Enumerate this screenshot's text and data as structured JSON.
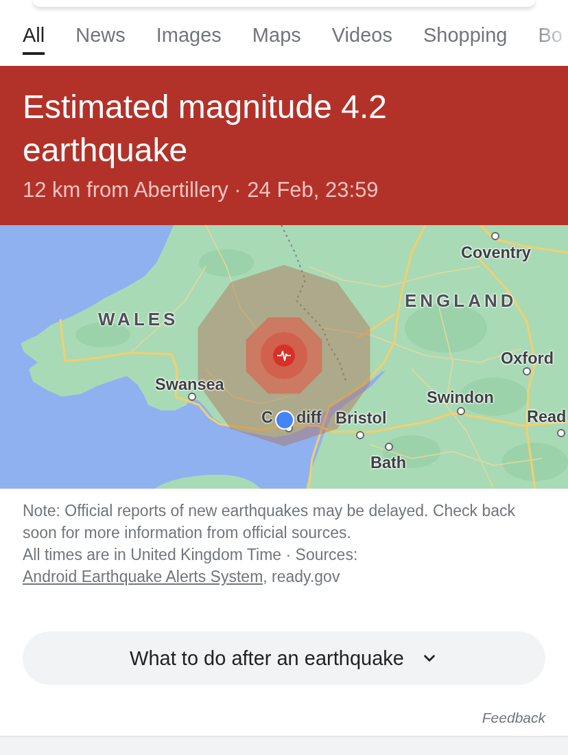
{
  "tabs": [
    {
      "label": "All",
      "selected": true
    },
    {
      "label": "News",
      "selected": false
    },
    {
      "label": "Images",
      "selected": false
    },
    {
      "label": "Maps",
      "selected": false
    },
    {
      "label": "Videos",
      "selected": false
    },
    {
      "label": "Shopping",
      "selected": false
    },
    {
      "label": "Bo",
      "selected": false
    }
  ],
  "alert": {
    "title": "Estimated magnitude 4.2 earthquake",
    "subtitle": "12 km from Abertillery · 24 Feb, 23:59"
  },
  "map": {
    "regions": [
      {
        "label": "WALES"
      },
      {
        "label": "ENGLAND"
      }
    ],
    "places": [
      {
        "kind": "city",
        "label": "Coventry"
      },
      {
        "kind": "city",
        "label": "Oxford"
      },
      {
        "kind": "city",
        "label": "Swansea"
      },
      {
        "kind": "city",
        "label": "Swindon"
      },
      {
        "kind": "located",
        "label_parts": [
          "C",
          "diff"
        ]
      },
      {
        "kind": "city",
        "label": "Bristol"
      },
      {
        "kind": "city",
        "label": "Read"
      },
      {
        "kind": "city",
        "label": "Bath"
      }
    ]
  },
  "notes": {
    "disclaimer": "Note: Official reports of new earthquakes may be delayed. Check back soon for more information from official sources.",
    "sources_prefix": "All times are in United Kingdom Time · Sources:",
    "sources_link": "Android Earthquake Alerts System",
    "sources_suffix": ", ready.gov"
  },
  "expander": {
    "label": "What to do after an earthquake",
    "expanded": false
  },
  "feedback": "Feedback"
}
